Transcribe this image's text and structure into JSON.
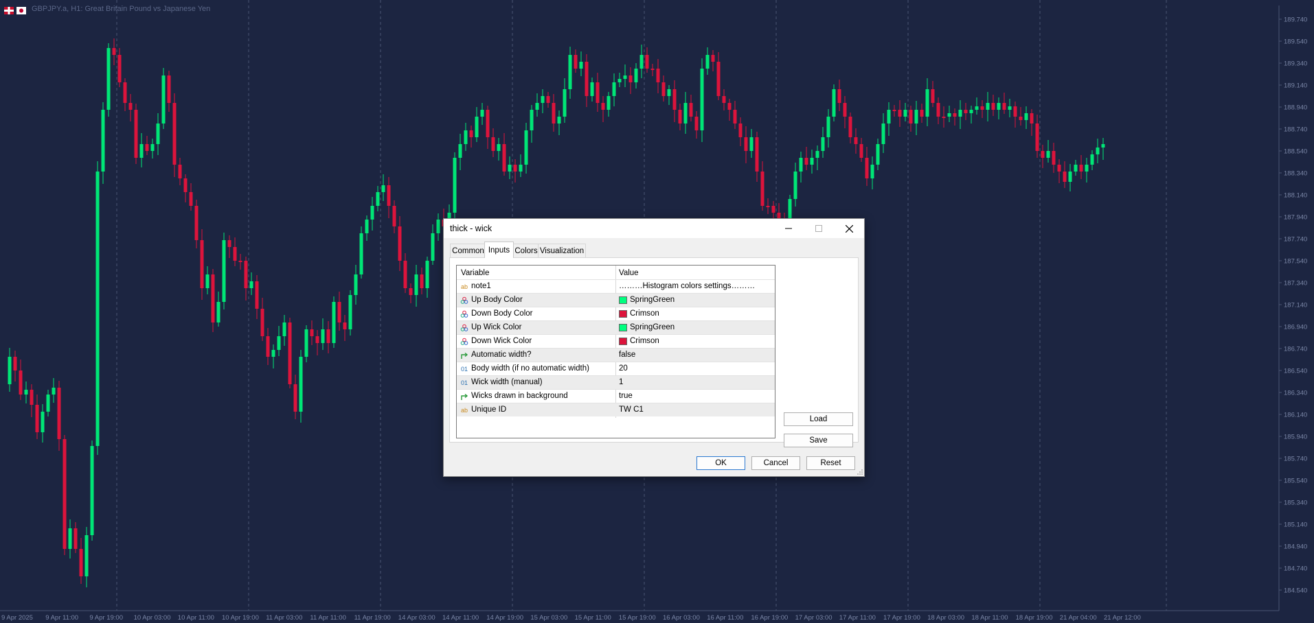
{
  "chart": {
    "symbol_title": "GBPJPY.a, H1:  Great Britain Pound vs Japanese Yen",
    "background": "#1c2541",
    "up_color": "#00e676",
    "down_color": "#dc143c",
    "price_labels": [
      "189.740",
      "189.540",
      "189.340",
      "189.140",
      "188.940",
      "188.740",
      "188.540",
      "188.340",
      "188.140",
      "187.940",
      "187.740",
      "187.540",
      "187.340",
      "187.140",
      "186.940",
      "186.740",
      "186.540",
      "186.340",
      "186.140",
      "185.940",
      "185.740",
      "185.540",
      "185.340",
      "185.140",
      "184.940",
      "184.740",
      "184.540"
    ],
    "time_labels": [
      "9 Apr 2025",
      "9 Apr 11:00",
      "9 Apr 19:00",
      "10 Apr 03:00",
      "10 Apr 11:00",
      "10 Apr 19:00",
      "11 Apr 03:00",
      "11 Apr 11:00",
      "11 Apr 19:00",
      "14 Apr 03:00",
      "14 Apr 11:00",
      "14 Apr 19:00",
      "15 Apr 03:00",
      "15 Apr 11:00",
      "15 Apr 19:00",
      "16 Apr 03:00",
      "16 Apr 11:00",
      "16 Apr 19:00",
      "17 Apr 03:00",
      "17 Apr 11:00",
      "17 Apr 19:00",
      "18 Apr 03:00",
      "18 Apr 11:00",
      "18 Apr 19:00",
      "21 Apr 04:00",
      "21 Apr 12:00"
    ]
  },
  "dialog": {
    "title": "thick - wick",
    "tabs": [
      "Common",
      "Inputs",
      "Colors",
      "Visualization"
    ],
    "active_tab": "Inputs",
    "columns": {
      "variable": "Variable",
      "value": "Value"
    },
    "rows": [
      {
        "icon": "text-icon",
        "variable": "note1",
        "value": "………Histogram colors settings………"
      },
      {
        "icon": "palette-icon",
        "variable": "Up Body Color",
        "value": "SpringGreen",
        "color": "#00ff7f"
      },
      {
        "icon": "palette-icon",
        "variable": "Down Body Color",
        "value": "Crimson",
        "color": "#dc143c"
      },
      {
        "icon": "palette-icon",
        "variable": "Up Wick Color",
        "value": "SpringGreen",
        "color": "#00ff7f"
      },
      {
        "icon": "palette-icon",
        "variable": "Down Wick Color",
        "value": "Crimson",
        "color": "#dc143c"
      },
      {
        "icon": "bool-icon",
        "variable": "Automatic width?",
        "value": "false"
      },
      {
        "icon": "number-icon",
        "variable": "Body width (if no automatic width)",
        "value": "20"
      },
      {
        "icon": "number-icon",
        "variable": "Wick width (manual)",
        "value": "1"
      },
      {
        "icon": "bool-icon",
        "variable": "Wicks drawn in background",
        "value": "true"
      },
      {
        "icon": "text-icon",
        "variable": "Unique ID",
        "value": "TW C1"
      }
    ],
    "buttons": {
      "load": "Load",
      "save": "Save",
      "ok": "OK",
      "cancel": "Cancel",
      "reset": "Reset"
    },
    "icon_glyphs": {
      "text": "ab",
      "number": "01"
    }
  }
}
